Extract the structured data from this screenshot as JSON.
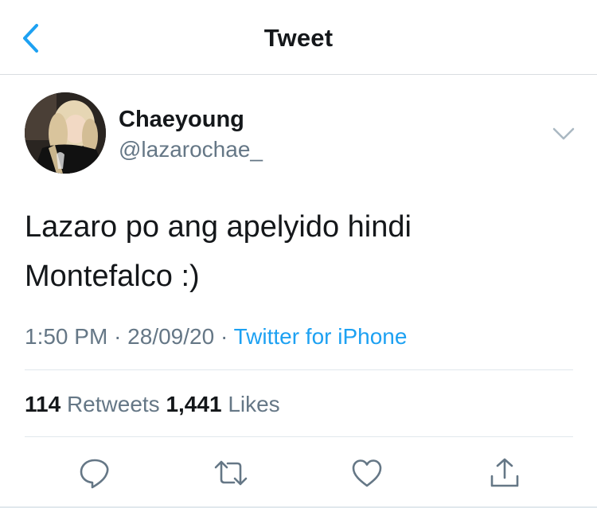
{
  "header": {
    "title": "Tweet",
    "back_icon": "chevron-left-icon"
  },
  "colors": {
    "accent": "#1da1f2",
    "text": "#14171a",
    "secondary": "#657786",
    "divider": "#e1e8ed"
  },
  "tweet": {
    "author_name": "Chaeyoung",
    "author_handle": "@lazarochae_",
    "text_line1": "Lazaro po ang apelyido hindi",
    "text_line2": "Montefalco :)",
    "time": "1:50 PM",
    "date": "28/09/20",
    "separator": "·",
    "source": "Twitter for iPhone"
  },
  "stats": {
    "retweets_count": "114",
    "retweets_label": "Retweets",
    "likes_count": "1,441",
    "likes_label": "Likes"
  },
  "actions": [
    {
      "icon": "reply-icon"
    },
    {
      "icon": "retweet-icon"
    },
    {
      "icon": "like-icon"
    },
    {
      "icon": "share-icon"
    }
  ]
}
